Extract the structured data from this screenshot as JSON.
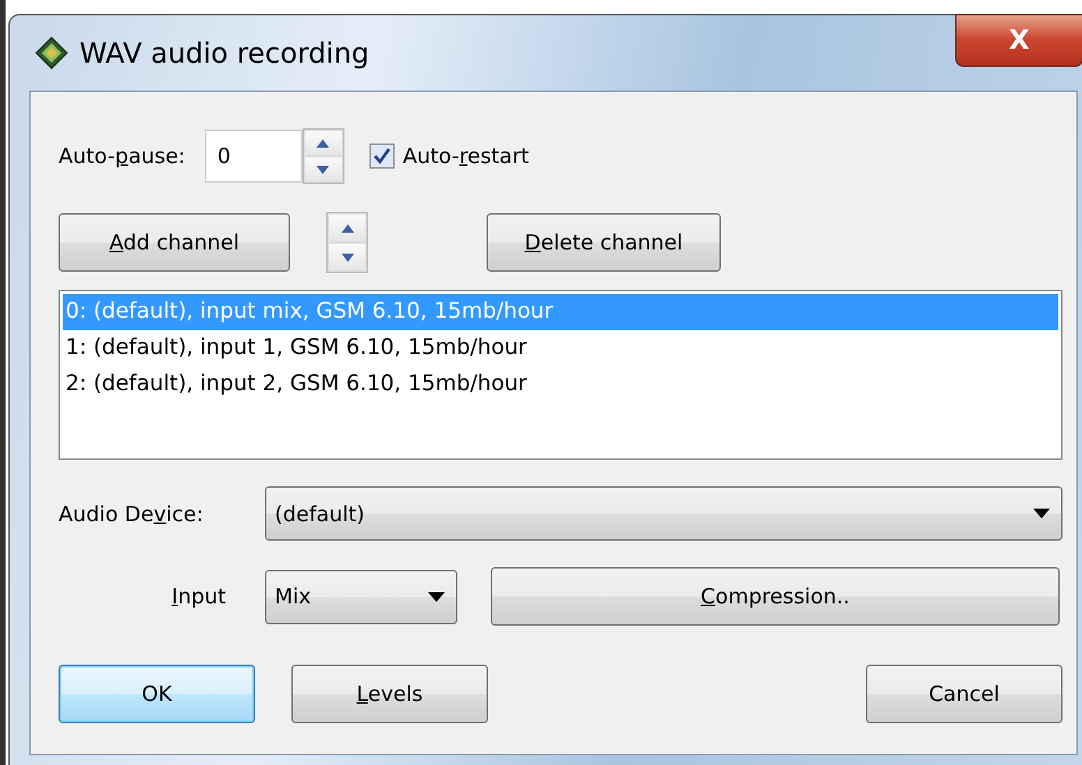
{
  "window": {
    "title": "WAV audio recording",
    "close": "X"
  },
  "auto_pause": {
    "label": {
      "before": "Auto-",
      "key": "p",
      "after": "ause:"
    },
    "value": "0"
  },
  "auto_restart": {
    "label": {
      "before": "Auto-",
      "key": "r",
      "after": "estart"
    },
    "checked": true
  },
  "buttons_top": [
    {
      "label": {
        "key": "A",
        "after": "dd channel"
      }
    },
    {
      "label": {
        "key": "D",
        "after": "elete channel"
      }
    }
  ],
  "channels": [
    {
      "text": "0: (default), input mix, GSM 6.10, 15mb/hour",
      "selected": true
    },
    {
      "text": "1: (default), input 1, GSM 6.10, 15mb/hour",
      "selected": false
    },
    {
      "text": "2: (default), input 2, GSM 6.10, 15mb/hour",
      "selected": false
    }
  ],
  "audio_device": {
    "label": {
      "before": "Audio De",
      "key": "v",
      "after": "ice:"
    },
    "value": "(default)"
  },
  "input": {
    "label": {
      "key": "I",
      "after": "nput"
    },
    "value": "Mix"
  },
  "compression": {
    "label": {
      "key": "C",
      "after": "ompression.."
    }
  },
  "buttons_bottom": [
    {
      "label": {
        "before": "OK"
      },
      "default": true
    },
    {
      "label": {
        "key": "L",
        "after": "evels"
      },
      "default": false
    },
    {
      "label": {
        "before": "Cancel"
      },
      "default": false
    }
  ]
}
